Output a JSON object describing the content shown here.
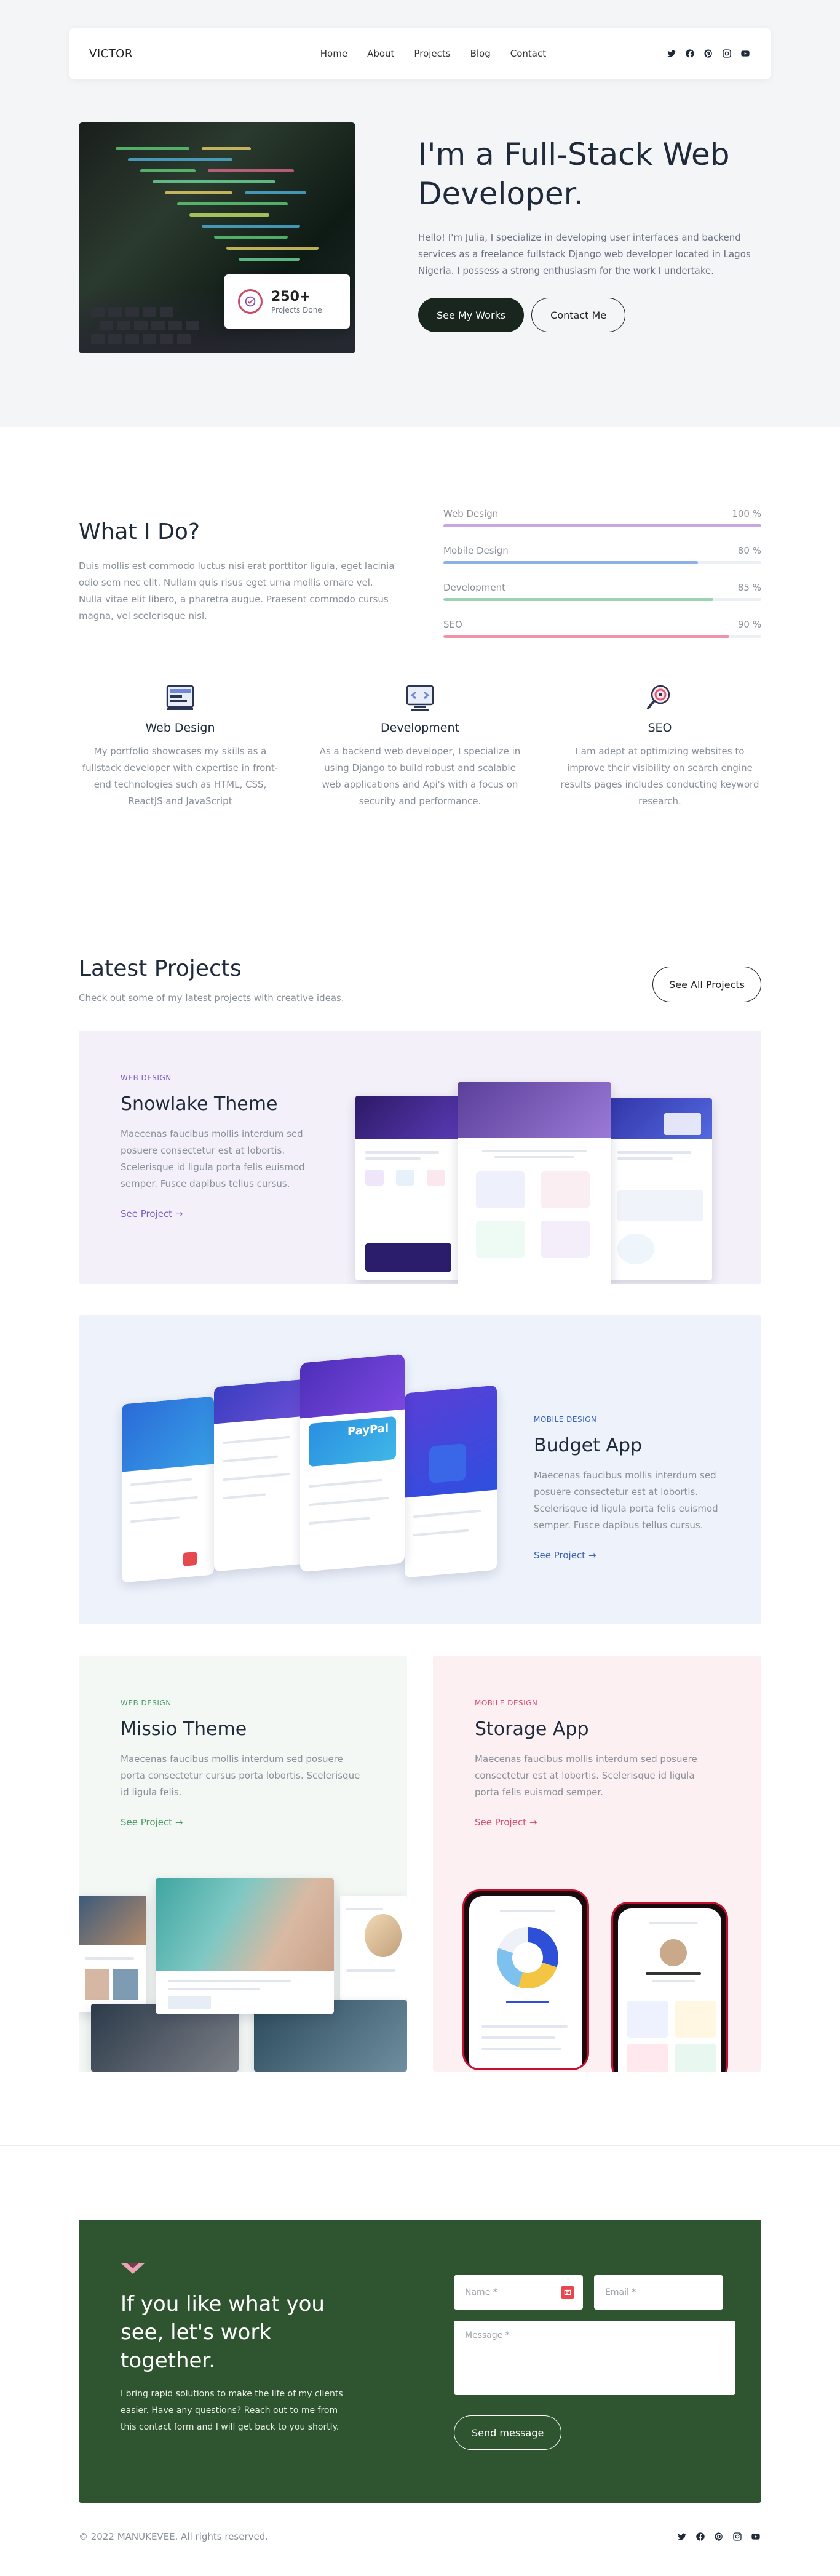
{
  "nav": {
    "logo": "VICTOR",
    "links": [
      "Home",
      "About",
      "Projects",
      "Blog",
      "Contact"
    ],
    "socials": [
      "twitter-icon",
      "facebook-icon",
      "pinterest-icon",
      "instagram-icon",
      "youtube-icon"
    ]
  },
  "hero": {
    "title": "I'm a Full-Stack Web Developer.",
    "description": "Hello! I'm Julia, I specialize in developing user interfaces and backend services as a freelance fullstack Django web developer located in Lagos Nigeria. I possess a strong enthusiasm for the work I undertake.",
    "primary_button": "See My Works",
    "secondary_button": "Contact Me",
    "badge": {
      "value": "250+",
      "label": "Projects Done"
    }
  },
  "what_i_do": {
    "title": "What I Do?",
    "description": "Duis mollis est commodo luctus nisi erat porttitor ligula, eget lacinia odio sem nec elit. Nullam quis risus eget urna mollis ornare vel. Nulla vitae elit libero, a pharetra augue. Praesent commodo cursus magna, vel scelerisque nisl.",
    "skills": [
      {
        "name": "Web Design",
        "percent_label": "100 %",
        "value": 100,
        "color": "#c7a6e2"
      },
      {
        "name": "Mobile Design",
        "percent_label": "80 %",
        "value": 80,
        "color": "#8db1e6"
      },
      {
        "name": "Development",
        "percent_label": "85 %",
        "value": 85,
        "color": "#9cd3b3"
      },
      {
        "name": "SEO",
        "percent_label": "90 %",
        "value": 90,
        "color": "#ee93a8"
      }
    ],
    "services": [
      {
        "icon": "web-design-icon",
        "title": "Web Design",
        "description": "My portfolio showcases my skills as a fullstack developer with expertise in front-end technologies such as HTML, CSS, ReactJS and JavaScript"
      },
      {
        "icon": "development-icon",
        "title": "Development",
        "description": "As a backend web developer, I specialize in using Django to build robust and scalable web applications and Api's with a focus on security and performance."
      },
      {
        "icon": "seo-icon",
        "title": "SEO",
        "description": "I am adept at optimizing websites to improve their visibility on search engine results pages includes conducting keyword research."
      }
    ]
  },
  "projects": {
    "title": "Latest Projects",
    "subtitle": "Check out some of my latest projects with creative ideas.",
    "see_all": "See All Projects",
    "items": [
      {
        "category": "Web Design",
        "title": "Snowlake Theme",
        "description": "Maecenas faucibus mollis interdum sed posuere consectetur est at lobortis. Scelerisque id ligula porta felis euismod semper. Fusce dapibus tellus cursus.",
        "link": "See Project →",
        "accent": "#7e5bc4"
      },
      {
        "category": "Mobile Design",
        "title": "Budget App",
        "description": "Maecenas faucibus mollis interdum sed posuere consectetur est at lobortis. Scelerisque id ligula porta felis euismod semper. Fusce dapibus tellus cursus.",
        "link": "See Project →",
        "accent": "#3a63b8"
      },
      {
        "category": "Web Design",
        "title": "Missio Theme",
        "description": "Maecenas faucibus mollis interdum sed posuere porta consectetur cursus porta lobortis. Scelerisque id ligula felis.",
        "link": "See Project →",
        "accent": "#4d9a6a"
      },
      {
        "category": "Mobile Design",
        "title": "Storage App",
        "description": "Maecenas faucibus mollis interdum sed posuere consectetur est at lobortis. Scelerisque id ligula porta felis euismod semper.",
        "link": "See Project →",
        "accent": "#d8506d"
      }
    ]
  },
  "contact": {
    "title": "If you like what you see, let's work together.",
    "description": "I bring rapid solutions to make the life of my clients easier. Have any questions? Reach out to me from this contact form and I will get back to you shortly.",
    "name_placeholder": "Name *",
    "email_placeholder": "Email *",
    "message_placeholder": "Message *",
    "submit": "Send message"
  },
  "footer": {
    "copyright": "© 2022 MANUKEVEE. All rights reserved."
  }
}
